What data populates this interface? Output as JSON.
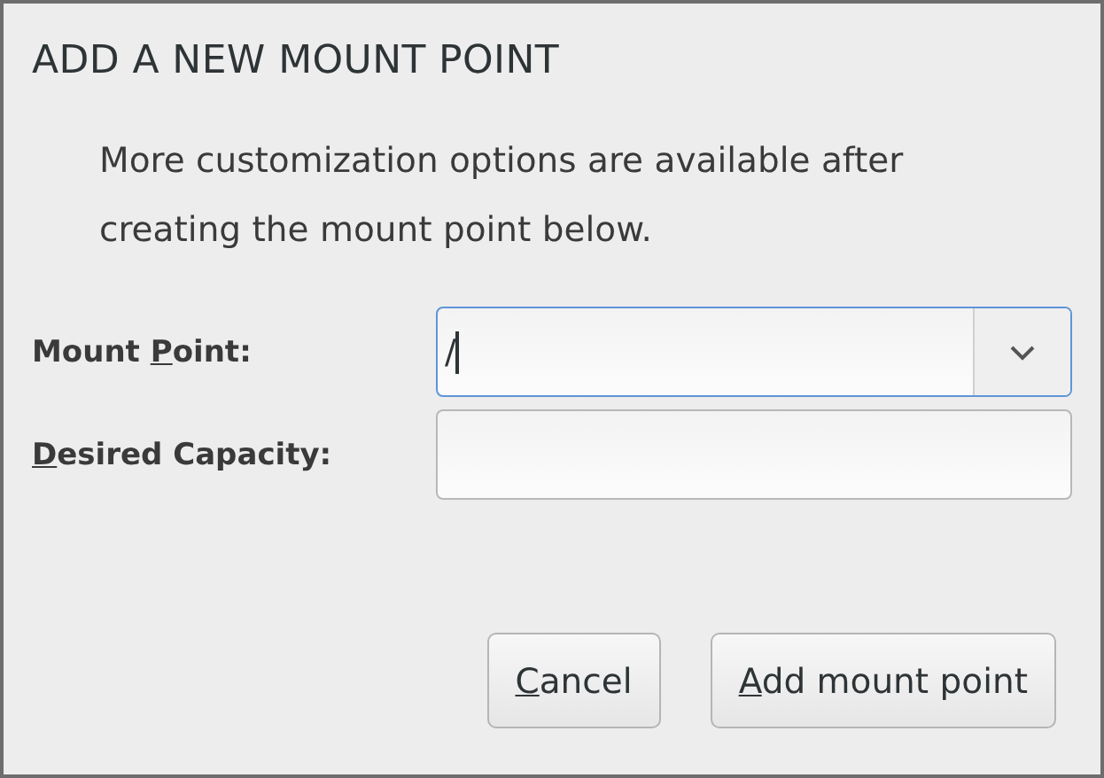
{
  "dialog": {
    "title": "ADD A NEW MOUNT POINT",
    "description": "More customization options are available after creating the mount point below."
  },
  "fields": [
    {
      "kind": "combo",
      "label": {
        "before": "Mount ",
        "key": "P",
        "after": "oint:"
      },
      "value": "/",
      "focused": true
    },
    {
      "kind": "entry",
      "label": {
        "key": "D",
        "after": "esired Capacity:"
      },
      "focused": false
    }
  ],
  "buttons": [
    {
      "label": {
        "key": "C",
        "after": "ancel"
      }
    },
    {
      "label": {
        "key": "A",
        "after": "dd mount point"
      }
    }
  ]
}
